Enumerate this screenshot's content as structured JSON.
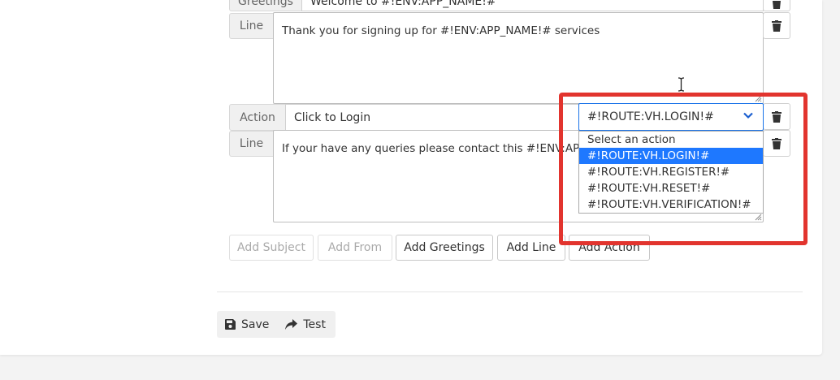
{
  "form": {
    "greetings": {
      "label": "Greetings",
      "value": "Welcome to #!ENV:APP_NAME!#"
    },
    "line1": {
      "label": "Line",
      "value": "Thank you for signing up for #!ENV:APP_NAME!# services"
    },
    "action": {
      "label": "Action",
      "text_value": "Click to Login",
      "selected_route": "#!ROUTE:VH.LOGIN!#"
    },
    "line2": {
      "label": "Line",
      "value": "If your have any queries please contact this #!ENV:APP_EMAIL!#"
    }
  },
  "dropdown": {
    "options": [
      "Select an action",
      "#!ROUTE:VH.LOGIN!#",
      "#!ROUTE:VH.REGISTER!#",
      "#!ROUTE:VH.RESET!#",
      "#!ROUTE:VH.VERIFICATION!#"
    ],
    "selected_index": 1
  },
  "add_buttons": {
    "subject": "Add Subject",
    "from": "Add From",
    "greetings": "Add Greetings",
    "line": "Add Line",
    "action": "Add Action"
  },
  "footer": {
    "save": "Save",
    "test": "Test"
  },
  "colors": {
    "highlight": "#e2342e",
    "selected_option": "#1e78ff",
    "select_border": "#1a73e8"
  }
}
